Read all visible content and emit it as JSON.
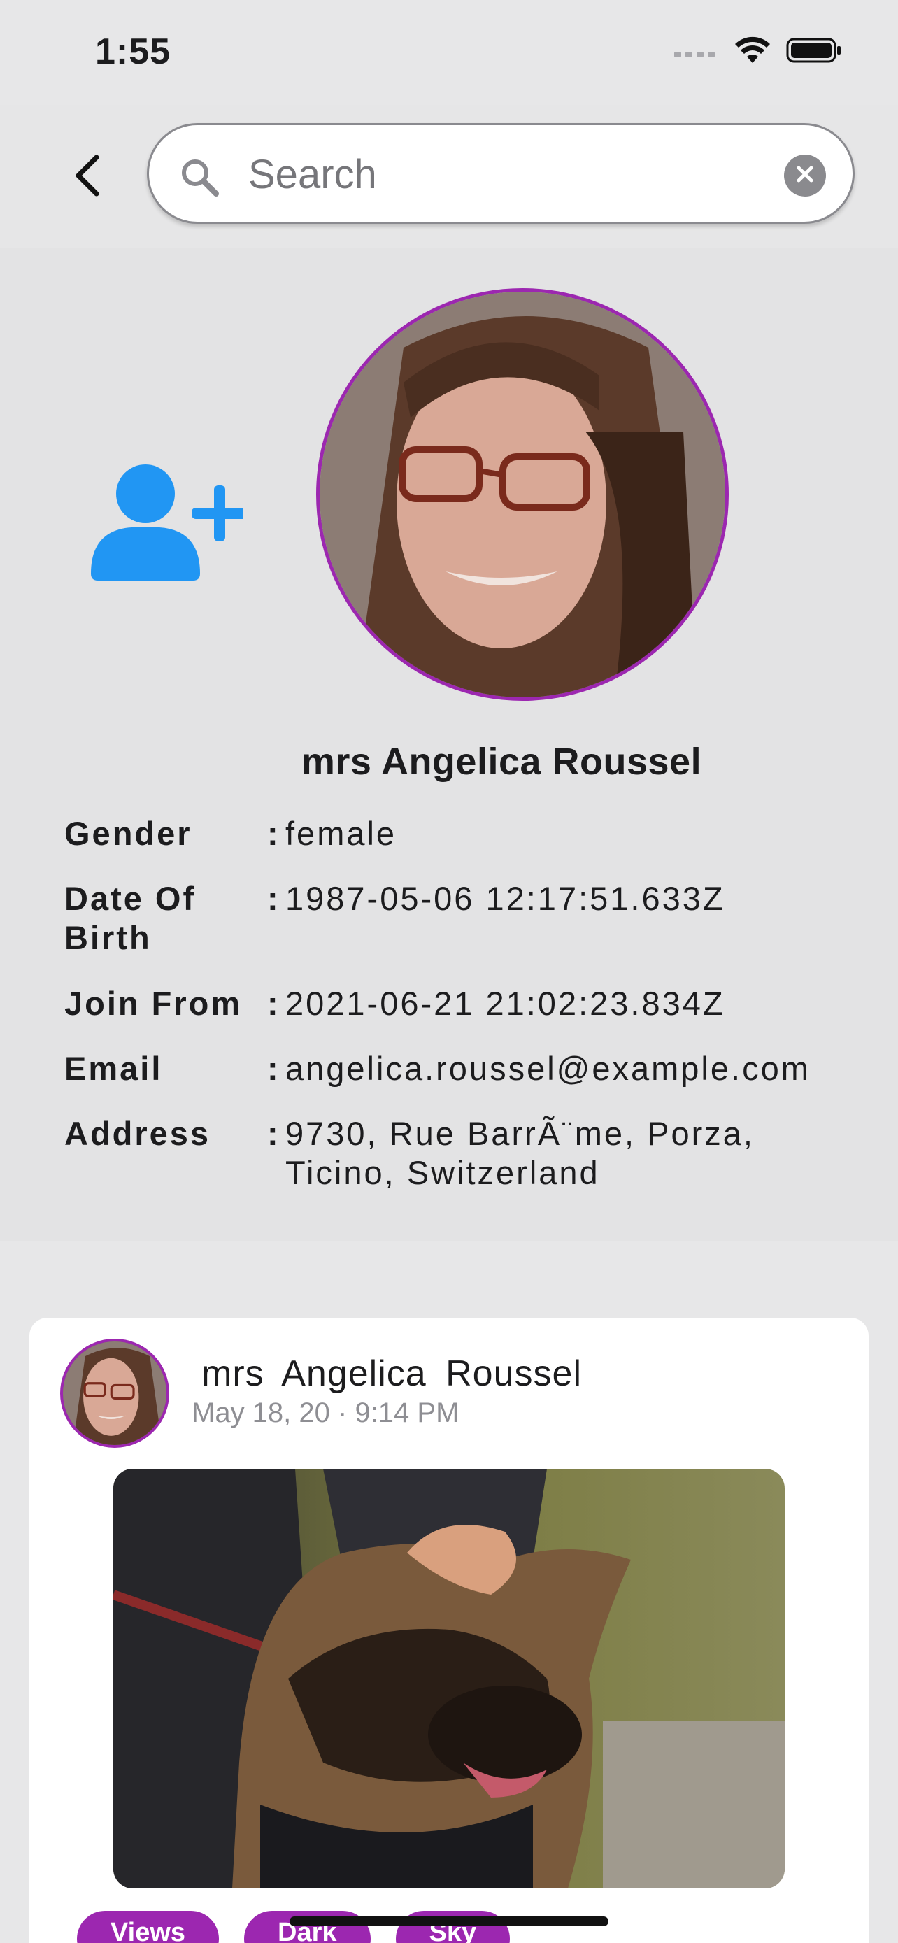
{
  "status_bar": {
    "time": "1:55",
    "signal_icon": "cellular-signal-icon",
    "wifi_icon": "wifi-icon",
    "battery_icon": "battery-icon"
  },
  "header": {
    "back_icon": "chevron-left-icon",
    "search": {
      "placeholder": "Search",
      "value": "",
      "search_icon": "search-icon",
      "clear_icon": "clear-circle-icon"
    }
  },
  "profile": {
    "add_friend_icon": "add-user-icon",
    "name": "mrs Angelica Roussel",
    "fields": [
      {
        "label": "Gender",
        "value": "female"
      },
      {
        "label": "Date Of Birth",
        "value": "1987-05-06 12:17:51.633Z"
      },
      {
        "label": "Join From",
        "value": "2021-06-21 21:02:23.834Z"
      },
      {
        "label": "Email",
        "value": "angelica.roussel@example.com"
      },
      {
        "label": "Address",
        "value": "9730, Rue BarrÃ¨me, Porza, Ticino, Switzerland"
      }
    ],
    "separator": ":"
  },
  "post": {
    "author": "mrs  Angelica  Roussel",
    "date": "May 18, 20 · 9:14 PM",
    "tags": [
      "Views",
      "Dark",
      "Sky"
    ]
  },
  "colors": {
    "accent": "#9c27b0",
    "add_user_blue": "#2196f3",
    "background": "#e7e7e8"
  }
}
